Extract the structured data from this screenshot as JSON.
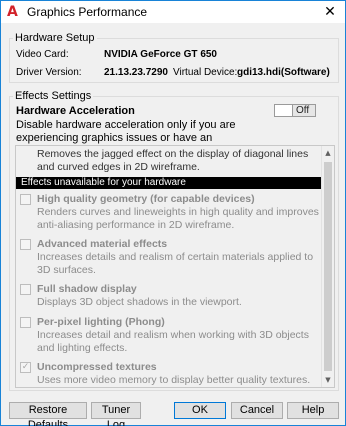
{
  "window": {
    "title": "Graphics Performance",
    "app_icon": "autocad-a-icon",
    "close_glyph": "✕"
  },
  "hardware_setup": {
    "legend": "Hardware Setup",
    "video_card_label": "Video Card:",
    "video_card_value": "NVIDIA GeForce GT 650",
    "driver_version_label": "Driver Version:",
    "driver_version_value": "21.13.23.7290",
    "virtual_device_label": "Virtual Device:",
    "virtual_device_value": "gdi13.hdi(Software)"
  },
  "effects_settings": {
    "legend": "Effects Settings",
    "hw_acceleration_title": "Hardware Acceleration",
    "hw_acceleration_desc": "Disable hardware acceleration only if you are experiencing graphics issues or have an incompatible video card.",
    "toggle_label": "Off",
    "toggle_on": false,
    "list": {
      "top_partial_text": "Removes the jagged effect on the display of diagonal lines and curved edges in 2D wireframe.",
      "section_header": "Effects unavailable for your hardware",
      "items": [
        {
          "title": "High quality geometry (for capable devices)",
          "desc": "Renders curves and lineweights in high quality and improves anti-aliasing performance in 2D wireframe.",
          "checked": false
        },
        {
          "title": "Advanced material effects",
          "desc": "Increases details and realism of certain materials applied to 3D surfaces.",
          "checked": false
        },
        {
          "title": "Full shadow display",
          "desc": "Displays 3D object shadows in the viewport.",
          "checked": false
        },
        {
          "title": "Per-pixel lighting (Phong)",
          "desc": "Increases detail and realism when working with 3D objects and lighting effects.",
          "checked": false
        },
        {
          "title": "Uncompressed textures",
          "desc": "Uses more video memory to display better quality textures.",
          "checked": true
        }
      ]
    }
  },
  "buttons": {
    "restore_defaults": "Restore Defaults",
    "tuner_log": "Tuner Log",
    "ok": "OK",
    "cancel": "Cancel",
    "help": "Help"
  },
  "colors": {
    "accent": "#0078d7",
    "disabled_text": "#8c8c8c",
    "section_header_bg": "#000000"
  }
}
